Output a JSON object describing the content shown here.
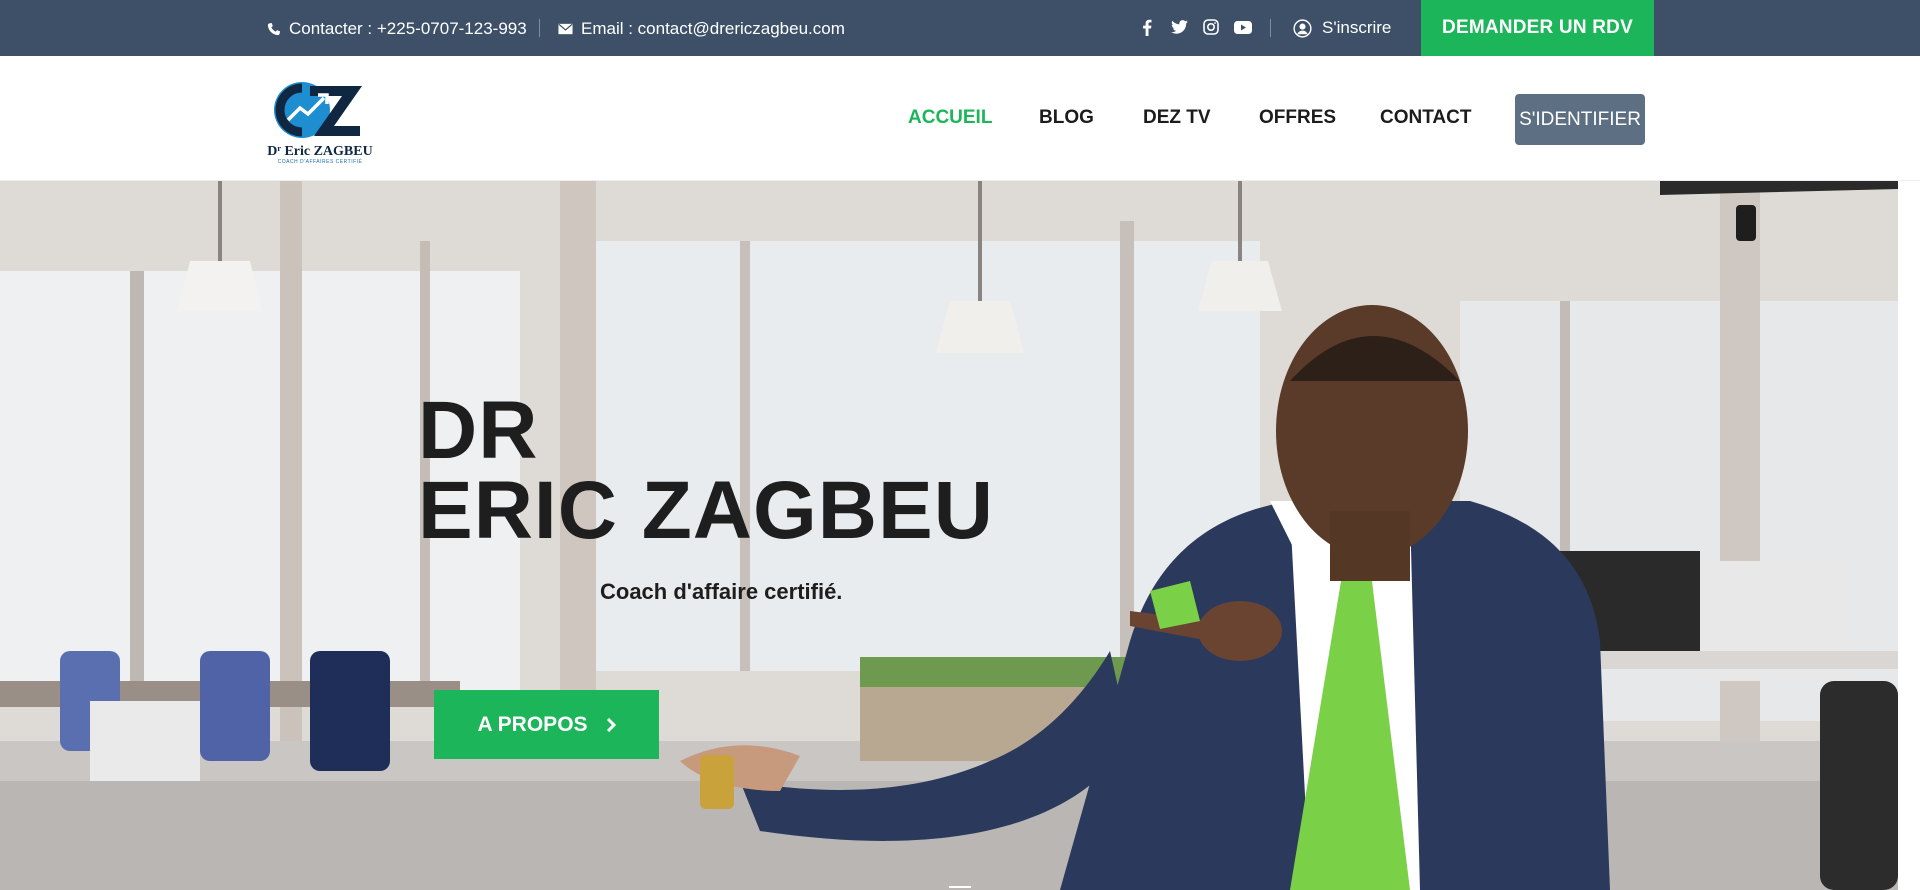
{
  "topbar": {
    "contact": "Contacter : +225-0707-123-993",
    "email": "Email : contact@drericzagbeu.com",
    "social": [
      "facebook-icon",
      "twitter-icon",
      "instagram-icon",
      "youtube-icon"
    ],
    "signup": "S'inscrire",
    "rdv_button": "DEMANDER UN RDV"
  },
  "header": {
    "logo_name": "Dʳ Eric ZAGBEU",
    "logo_tagline": "COACH D'AFFAIRES CERTIFIÉ",
    "nav": [
      {
        "label": "ACCUEIL",
        "active": true
      },
      {
        "label": "BLOG",
        "active": false
      },
      {
        "label": "DEZ TV",
        "active": false
      },
      {
        "label": "OFFRES",
        "active": false
      },
      {
        "label": "CONTACT",
        "active": false
      }
    ],
    "login_button": "S'IDENTIFIER"
  },
  "hero": {
    "title_line1": "DR",
    "title_line2": "ERIC ZAGBEU",
    "subtitle": "Coach d'affaire certifié.",
    "button": "A PROPOS"
  },
  "colors": {
    "topbar": "#3d5068",
    "accent_green": "#1db55a",
    "login_button": "#5d6f83",
    "text_dark": "#1e1e1e"
  }
}
